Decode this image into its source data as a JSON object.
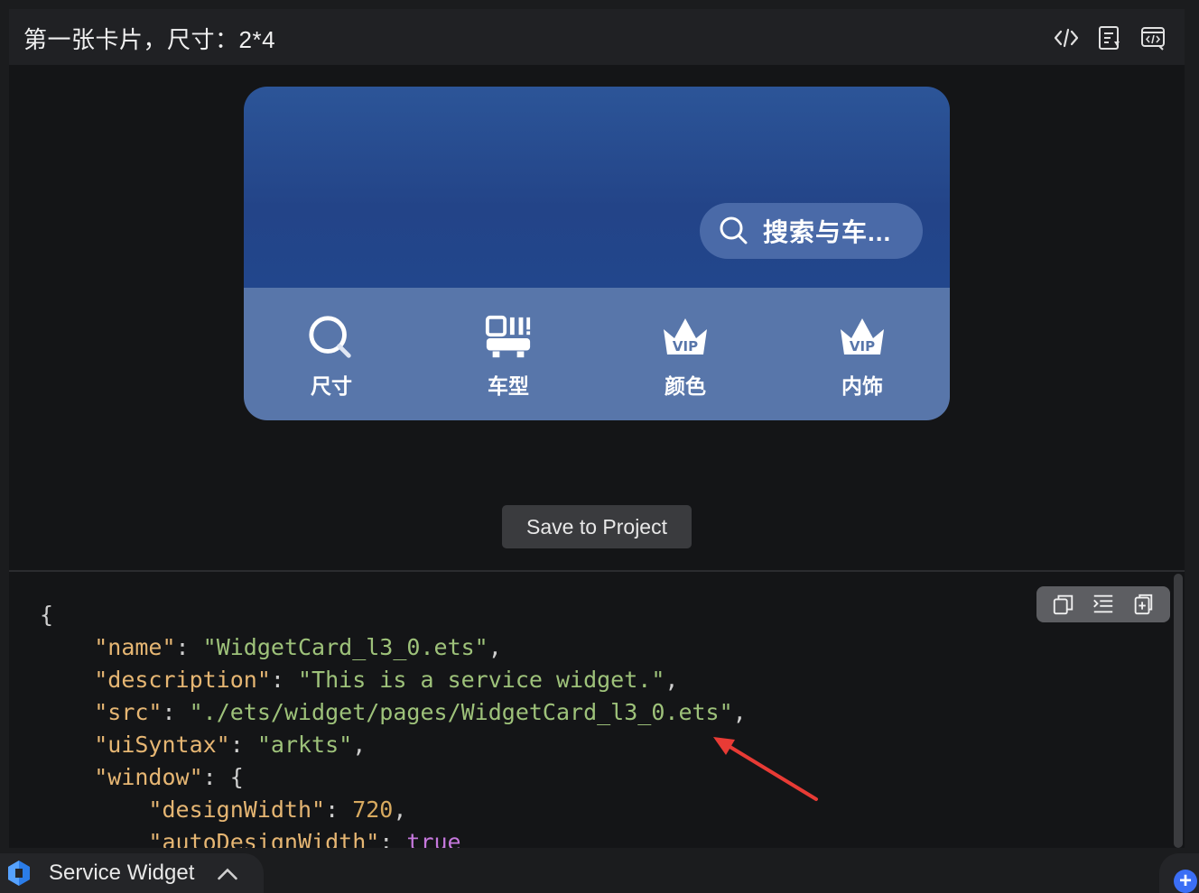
{
  "header": {
    "title": "第一张卡片，尺寸：2*4"
  },
  "header_icons": [
    "code-view-icon",
    "code-file-icon",
    "preview-code-icon"
  ],
  "card": {
    "search_placeholder": "搜索与车...",
    "shortcuts": [
      {
        "label": "尺寸",
        "icon": "search-magnifier-icon"
      },
      {
        "label": "车型",
        "icon": "car-model-icon"
      },
      {
        "label": "颜色",
        "icon": "vip-crown-icon"
      },
      {
        "label": "内饰",
        "icon": "vip-crown-icon"
      }
    ],
    "colors": {
      "top": "#234488",
      "bottom": "#5876aa",
      "pill": "#4a6aa8"
    }
  },
  "actions": {
    "save_label": "Save to Project"
  },
  "code_tools": [
    "copy-icon",
    "format-icon",
    "insert-file-icon"
  ],
  "code": {
    "open": "{",
    "lines": [
      {
        "key": "\"name\"",
        "sep": ": ",
        "value": "\"WidgetCard_l3_0.ets\"",
        "tail": ","
      },
      {
        "key": "\"description\"",
        "sep": ": ",
        "value": "\"This is a service widget.\"",
        "tail": ","
      },
      {
        "key": "\"src\"",
        "sep": ": ",
        "value": "\"./ets/widget/pages/WidgetCard_l3_0.ets\"",
        "tail": ","
      },
      {
        "key": "\"uiSyntax\"",
        "sep": ": ",
        "value": "\"arkts\"",
        "tail": ","
      },
      {
        "key": "\"window\"",
        "sep": ": ",
        "value": "{",
        "tail": ""
      }
    ],
    "nested": [
      {
        "key": "\"designWidth\"",
        "sep": ": ",
        "value": "720",
        "tail": ","
      },
      {
        "key": "\"autoDesignWidth\"",
        "sep": ": ",
        "value": "true",
        "tail": ""
      }
    ]
  },
  "bottom_bar": {
    "tab_label": "Service Widget",
    "add_label": "+"
  }
}
